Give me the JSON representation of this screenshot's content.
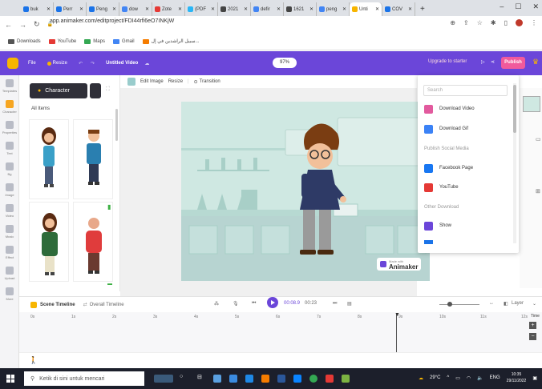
{
  "browser": {
    "tabs": [
      {
        "label": "buk",
        "color": "#1a73e8"
      },
      {
        "label": "Perr",
        "color": "#1a73e8"
      },
      {
        "label": "Peng",
        "color": "#1a73e8"
      },
      {
        "label": "dow",
        "color": "#4285f4"
      },
      {
        "label": "Zote",
        "color": "#e53935"
      },
      {
        "label": "(PDF",
        "color": "#29b6f6"
      },
      {
        "label": "2021",
        "color": "#444"
      },
      {
        "label": "defir",
        "color": "#4285f4"
      },
      {
        "label": "1621",
        "color": "#444"
      },
      {
        "label": "peng",
        "color": "#4285f4"
      },
      {
        "label": "Unti",
        "color": "#f7b500",
        "active": true
      },
      {
        "label": "COV",
        "color": "#1a73e8"
      }
    ],
    "url": "app.animaker.com/editproject/FDI44rfi6eO7INKjW",
    "bookmarks": [
      {
        "label": "Downloads",
        "color": "#555"
      },
      {
        "label": "YouTube",
        "color": "#e53935"
      },
      {
        "label": "Maps",
        "color": "#34a853"
      },
      {
        "label": "Gmail",
        "color": "#4285f4"
      },
      {
        "label": "سبيل الراشدين في إل...",
        "color": "#f57c00"
      }
    ]
  },
  "app": {
    "file_label": "File",
    "resize_label": "Resize",
    "project_title": "Untitled Video",
    "zoom": "97%",
    "upgrade_label": "Upgrade to starter",
    "publish_label": "Publish",
    "accent": "#6b46d9"
  },
  "rail": [
    "Templates",
    "Character",
    "Properties",
    "Text",
    "Bg",
    "Image",
    "Video",
    "Music",
    "Effect",
    "Upload",
    "More"
  ],
  "panel": {
    "tab_label": "Character",
    "all_items": "All Items"
  },
  "stage_toolbar": {
    "edit_image": "Edit Image",
    "resize": "Resize",
    "transition": "Transition"
  },
  "scene": {
    "watermark_small": "Made with",
    "watermark": "Animaker"
  },
  "dropdown": {
    "search_placeholder": "Search",
    "items": [
      {
        "label": "Download Video",
        "color": "#e25a9e"
      },
      {
        "label": "Download Gif",
        "color": "#3b82f6"
      }
    ],
    "social_heading": "Publish Social Media",
    "social": [
      {
        "label": "Facebook Page",
        "color": "#1877f2"
      },
      {
        "label": "YouTube",
        "color": "#e53935"
      }
    ],
    "other_heading": "Other Download",
    "other": [
      {
        "label": "Show",
        "color": "#6b46d9"
      }
    ]
  },
  "timeline": {
    "scene_timeline": "Scene Timeline",
    "overall_timeline": "Overall Timeline",
    "time_current": "00:08.9",
    "time_total": "00:23",
    "layer_label": "Layer",
    "ticks": [
      "0s",
      "1s",
      "2s",
      "3s",
      "4s",
      "5s",
      "6s",
      "7s",
      "8s",
      "9s",
      "10s",
      "11s",
      "12s"
    ],
    "time_label": "Time"
  },
  "taskbar": {
    "search_placeholder": "Ketik di sini untuk mencari",
    "temperature": "29°C",
    "lang": "ENG",
    "time": "10:35",
    "date": "29/11/2022"
  }
}
